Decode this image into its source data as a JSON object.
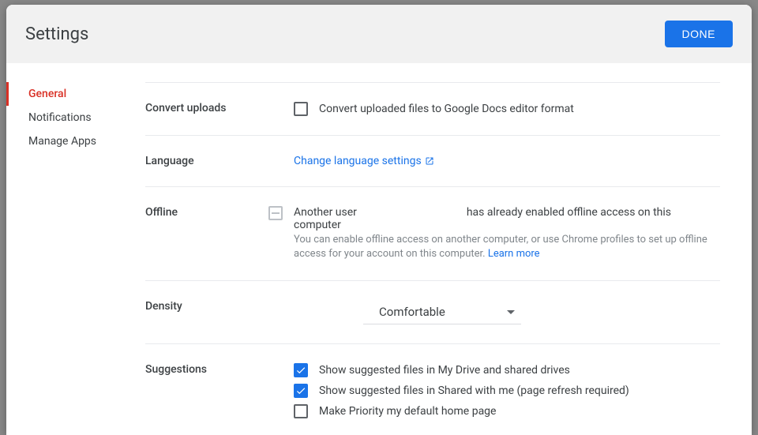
{
  "header": {
    "title": "Settings",
    "done_label": "DONE"
  },
  "sidebar": {
    "items": [
      {
        "label": "General",
        "active": true
      },
      {
        "label": "Notifications",
        "active": false
      },
      {
        "label": "Manage Apps",
        "active": false
      }
    ]
  },
  "sections": {
    "convert": {
      "label": "Convert uploads",
      "checkbox_label": "Convert uploaded files to Google Docs editor format"
    },
    "language": {
      "label": "Language",
      "link_text": "Change language settings"
    },
    "offline": {
      "label": "Offline",
      "primary_pre": "Another user",
      "primary_post": "has already enabled offline access on this computer",
      "secondary": "You can enable offline access on another computer, or use Chrome profiles to set up offline access for your account on this computer. ",
      "learn_more": "Learn more"
    },
    "density": {
      "label": "Density",
      "selected": "Comfortable"
    },
    "suggestions": {
      "label": "Suggestions",
      "opt1": "Show suggested files in My Drive and shared drives",
      "opt2": "Show suggested files in Shared with me (page refresh required)",
      "opt3": "Make Priority my default home page"
    }
  }
}
